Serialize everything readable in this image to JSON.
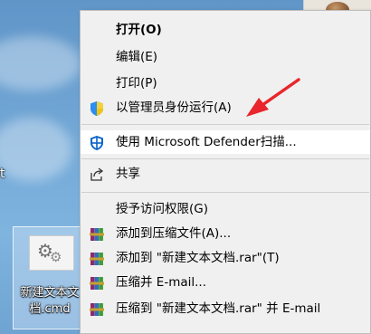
{
  "desktop": {
    "side_label": "t",
    "file_icon": {
      "name_line1": "新建文本文",
      "name_line2": "档.cmd"
    }
  },
  "context_menu": {
    "open": "打开(O)",
    "edit": "编辑(E)",
    "print": "打印(P)",
    "run_as_admin": "以管理员身份运行(A)",
    "defender_scan": "使用 Microsoft Defender扫描...",
    "share": "共享",
    "grant_access": "授予访问权限(G)",
    "add_to_archive": "添加到压缩文件(A)...",
    "add_to_rar": "添加到 \"新建文本文档.rar\"(T)",
    "compress_email": "压缩并 E-mail...",
    "compress_rar_email": "压缩到 \"新建文本文档.rar\" 并 E-mail"
  },
  "colors": {
    "menu_bg": "#f0f0f0",
    "highlight": "#ffffff",
    "annotation_arrow": "#e8262b",
    "desktop_bg": "#6fa3d1"
  },
  "icons": {
    "run_as_admin": "uac-shield-icon",
    "defender_scan": "defender-shield-icon",
    "share": "share-icon",
    "winrar": "winrar-books-icon"
  }
}
